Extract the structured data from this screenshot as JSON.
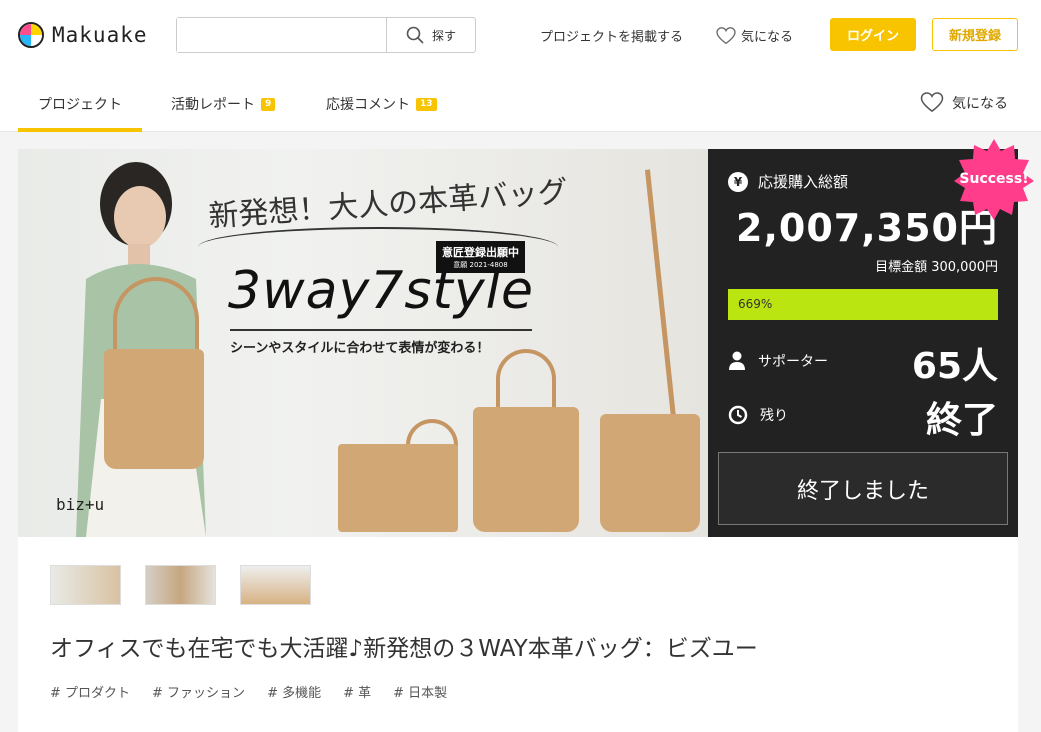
{
  "header": {
    "logo_text": "Makuake",
    "search": {
      "placeholder": "",
      "button_label": "探す"
    },
    "nav": {
      "post_project": "プロジェクトを掲載する",
      "favorites": "気になる"
    },
    "login_label": "ログイン",
    "signup_label": "新規登録"
  },
  "tabs": [
    {
      "label": "プロジェクト"
    },
    {
      "label": "活動レポート",
      "badge": "9"
    },
    {
      "label": "応援コメント",
      "badge": "13"
    }
  ],
  "favorite_tab": "気になる",
  "hero": {
    "catch": "新発想！大人の本革バッグ",
    "registration": "意匠登録出願中",
    "registration_no": "意願 2021-4808",
    "style_text": "3way7style",
    "subtitle": "シーンやスタイルに合わせて表情が変わる！",
    "brand": "biz+u"
  },
  "panel": {
    "total_label": "応援購入総額",
    "amount": "2,007,350円",
    "goal": "目標金額 300,000円",
    "progress_label": "669%",
    "progress": 1.0,
    "supporters_label": "サポーター",
    "supporters_value": "65人",
    "remaining_label": "残り",
    "remaining_value": "終了",
    "ended_button": "終了しました",
    "success_badge": "Success!"
  },
  "project": {
    "title": "オフィスでも在宅でも大活躍♪新発想の３WAY本革バッグ：ビズユー",
    "tags": [
      "# プロダクト",
      "# ファッション",
      "# 多機能",
      "# 革",
      "# 日本製"
    ]
  },
  "colors": {
    "accent": "#f8c400",
    "progress": "#bbe510",
    "success": "#ff3d8b",
    "panel": "#222222"
  }
}
